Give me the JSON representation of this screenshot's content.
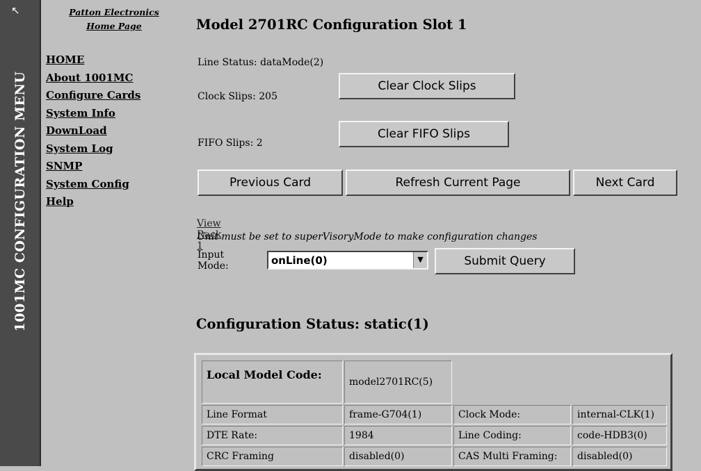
{
  "sidebar_strip": {
    "label": "1001MC CONFIGURATION MENU",
    "icon": "cursor-arrow-icon"
  },
  "brand": {
    "company": "Patton Electronics",
    "home": "Home Page"
  },
  "nav": [
    "HOME",
    "About 1001MC",
    "Configure Cards",
    "System Info",
    "DownLoad",
    "System Log",
    "SNMP",
    "System Config",
    "Help"
  ],
  "page": {
    "title": "Model 2701RC Configuration Slot 1",
    "line_status": "Line Status: dataMode(2)",
    "clock_slips": "Clock Slips: 205",
    "fifo_slips": "FIFO Slips: 2",
    "buttons": {
      "clear_clock": "Clear Clock Slips",
      "clear_fifo": "Clear FIFO Slips",
      "prev": "Previous Card",
      "refresh": "Refresh Current Page",
      "next": "Next Card",
      "submit": "Submit Query"
    },
    "view_rack": "View Rack 1",
    "note": "Unit must be set to superVisoryMode to make configuration changes",
    "input_mode_label": "Input Mode:",
    "input_mode_value": "onLine(0)",
    "config_status": "Configuration Status: static(1)"
  },
  "table": {
    "model_code_label": "Local Model Code:",
    "model_code_value": "model2701RC(5)",
    "rows": [
      [
        "Line Format",
        "frame-G704(1)",
        "Clock Mode:",
        "internal-CLK(1)"
      ],
      [
        "DTE Rate:",
        "1984",
        "Line Coding:",
        "code-HDB3(0)"
      ],
      [
        "CRC Framing",
        "disabled(0)",
        "CAS Multi Framing:",
        "disabled(0)"
      ]
    ]
  }
}
